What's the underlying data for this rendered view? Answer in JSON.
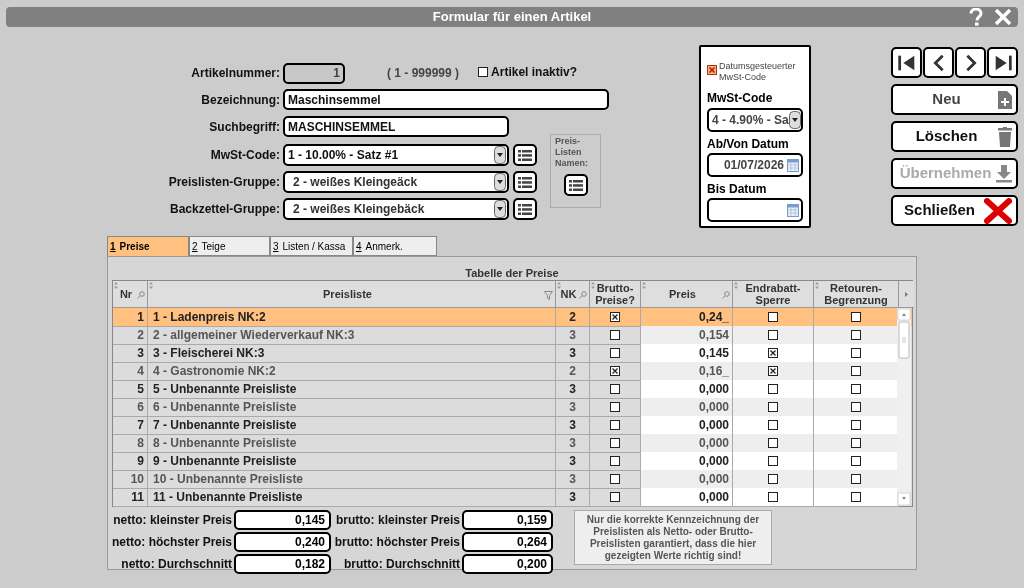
{
  "window": {
    "title": "Formular für einen Artikel"
  },
  "form": {
    "artikelnummer": {
      "label": "Artikelnummer:",
      "value": "1",
      "disabled": true
    },
    "range": "( 1 - 999999 )",
    "inaktiv": {
      "label": "Artikel inaktiv?",
      "checked": false
    },
    "bezeichnung": {
      "label": "Bezeichnung:",
      "value": "Maschinsemmel"
    },
    "suchbegriff": {
      "label": "Suchbegriff:",
      "value": "MASCHINSEMMEL"
    },
    "selects": [
      {
        "label": "MwSt-Code:",
        "value": "1 - 10.00% - Satz #1"
      },
      {
        "label": "Preislisten-Gruppe:",
        "value": "2 - weißes Kleingeäck"
      },
      {
        "label": "Backzettel-Gruppe:",
        "value": "2 - weißes Kleingebäck"
      }
    ],
    "preislisten_namen": {
      "lines": [
        "Preis-",
        "Listen",
        "Namen:"
      ]
    }
  },
  "mwst_panel": {
    "datumsgesteuert": {
      "label": "Datumsgesteuerter MwSt-Code",
      "checked": true
    },
    "code_label": "MwSt-Code",
    "code_value": "4 - 4.90% - Sa",
    "von_label": "Ab/Von Datum",
    "von_value": "01/07/2026",
    "bis_label": "Bis Datum"
  },
  "buttons": [
    {
      "label": "Neu",
      "kind": "new",
      "disabled": false
    },
    {
      "label": "Löschen",
      "kind": "delete",
      "disabled": false
    },
    {
      "label": "Übernehmen",
      "kind": "save",
      "disabled": true
    },
    {
      "label": "Schließen",
      "kind": "close",
      "disabled": false
    }
  ],
  "tabs": [
    {
      "key": "1",
      "label": "Preise",
      "selected": true
    },
    {
      "key": "2",
      "label": "Teige",
      "selected": false
    },
    {
      "key": "3",
      "label": "Listen / Kassa",
      "selected": false
    },
    {
      "key": "4",
      "label": "Anmerk.",
      "selected": false
    }
  ],
  "table": {
    "title": "Tabelle der Preise",
    "columns": [
      {
        "label": "Nr",
        "kind": "search"
      },
      {
        "label": "Preisliste",
        "kind": "filter"
      },
      {
        "label": "NK",
        "kind": "search"
      },
      {
        "label": "Brutto-Preise?",
        "kind": "plain"
      },
      {
        "label": "Preis",
        "kind": "search"
      },
      {
        "label": "Endrabatt-Sperre",
        "kind": "plain"
      },
      {
        "label": "Retouren-Begrenzung",
        "kind": "plain"
      }
    ],
    "rows": [
      {
        "nr": "1",
        "preisliste": "1 - Ladenpreis NK:2",
        "nk": "2",
        "brutto": true,
        "preis": "0,24_",
        "endrabatt": false,
        "retouren": false,
        "selected": true
      },
      {
        "nr": "2",
        "preisliste": "2 - allgemeiner Wiederverkauf NK:3",
        "nk": "3",
        "brutto": false,
        "preis": "0,154",
        "endrabatt": false,
        "retouren": false,
        "selected": false
      },
      {
        "nr": "3",
        "preisliste": "3 - Fleischerei NK:3",
        "nk": "3",
        "brutto": false,
        "preis": "0,145",
        "endrabatt": true,
        "retouren": false,
        "selected": false
      },
      {
        "nr": "4",
        "preisliste": "4 - Gastronomie NK:2",
        "nk": "2",
        "brutto": true,
        "preis": "0,16_",
        "endrabatt": true,
        "retouren": false,
        "selected": false
      },
      {
        "nr": "5",
        "preisliste": "5 - Unbenannte Preisliste",
        "nk": "3",
        "brutto": false,
        "preis": "0,000",
        "endrabatt": false,
        "retouren": false,
        "selected": false
      },
      {
        "nr": "6",
        "preisliste": "6 - Unbenannte Preisliste",
        "nk": "3",
        "brutto": false,
        "preis": "0,000",
        "endrabatt": false,
        "retouren": false,
        "selected": false
      },
      {
        "nr": "7",
        "preisliste": "7 - Unbenannte Preisliste",
        "nk": "3",
        "brutto": false,
        "preis": "0,000",
        "endrabatt": false,
        "retouren": false,
        "selected": false
      },
      {
        "nr": "8",
        "preisliste": "8 - Unbenannte Preisliste",
        "nk": "3",
        "brutto": false,
        "preis": "0,000",
        "endrabatt": false,
        "retouren": false,
        "selected": false
      },
      {
        "nr": "9",
        "preisliste": "9 - Unbenannte Preisliste",
        "nk": "3",
        "brutto": false,
        "preis": "0,000",
        "endrabatt": false,
        "retouren": false,
        "selected": false
      },
      {
        "nr": "10",
        "preisliste": "10 - Unbenannte Preisliste",
        "nk": "3",
        "brutto": false,
        "preis": "0,000",
        "endrabatt": false,
        "retouren": false,
        "selected": false
      },
      {
        "nr": "11",
        "preisliste": "11 - Unbenannte Preisliste",
        "nk": "3",
        "brutto": false,
        "preis": "0,000",
        "endrabatt": false,
        "retouren": false,
        "selected": false
      }
    ]
  },
  "summary": {
    "netto": [
      {
        "label": "netto: kleinster Preis",
        "value": "0,145"
      },
      {
        "label": "netto: höchster Preis",
        "value": "0,240"
      },
      {
        "label": "netto: Durchschnitt",
        "value": "0,182"
      }
    ],
    "brutto": [
      {
        "label": "brutto: kleinster Preis",
        "value": "0,159"
      },
      {
        "label": "brutto: höchster Preis",
        "value": "0,264"
      },
      {
        "label": "brutto: Durchschnitt",
        "value": "0,200"
      }
    ],
    "note": "Nur die korrekte Kennzeichnung der Preislisten als Netto- oder Brutto-Preislisten garantiert, dass die hier gezeigten Werte richtig sind!"
  }
}
